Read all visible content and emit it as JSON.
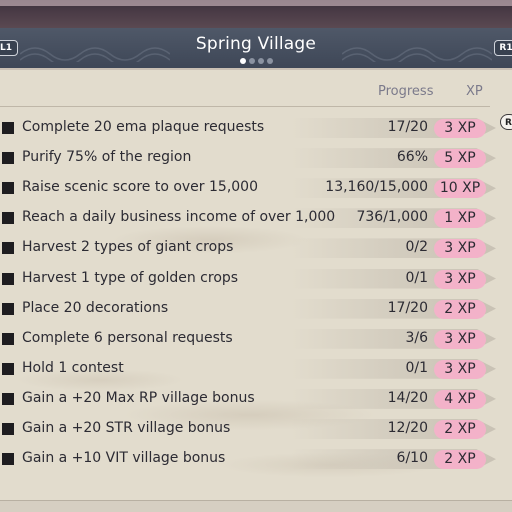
{
  "header": {
    "title": "Spring Village",
    "left_button": "L1",
    "right_button": "R1",
    "page_indicator": {
      "current": 1,
      "total": 4
    }
  },
  "columns": {
    "progress": "Progress",
    "xp": "XP"
  },
  "side_tab": "R",
  "requests": [
    {
      "name": "Complete 20 ema plaque requests",
      "progress": "17/20",
      "xp": "3 XP"
    },
    {
      "name": "Purify 75% of the region",
      "progress": "66%",
      "xp": "5 XP"
    },
    {
      "name": "Raise scenic score to over 15,000",
      "progress": "13,160/15,000",
      "xp": "10 XP"
    },
    {
      "name": "Reach a daily business income of over 1,000",
      "progress": "736/1,000",
      "xp": "1 XP"
    },
    {
      "name": "Harvest 2 types of giant crops",
      "progress": "0/2",
      "xp": "3 XP"
    },
    {
      "name": "Harvest 1 type of golden crops",
      "progress": "0/1",
      "xp": "3 XP"
    },
    {
      "name": "Place 20 decorations",
      "progress": "17/20",
      "xp": "2 XP"
    },
    {
      "name": "Complete 6 personal requests",
      "progress": "3/6",
      "xp": "3 XP"
    },
    {
      "name": "Hold 1 contest",
      "progress": "0/1",
      "xp": "3 XP"
    },
    {
      "name": "Gain a +20 Max RP village bonus",
      "progress": "14/20",
      "xp": "4 XP"
    },
    {
      "name": "Gain a +20 STR village bonus",
      "progress": "12/20",
      "xp": "2 XP"
    },
    {
      "name": "Gain a +10 VIT village bonus",
      "progress": "6/10",
      "xp": "2 XP"
    }
  ],
  "colors": {
    "header_bg": "#464f5f",
    "panel_bg": "#e2dccd",
    "xp_badge": "#f3b2c9",
    "text": "#2c2b33",
    "column_header": "#7b7a8b"
  }
}
